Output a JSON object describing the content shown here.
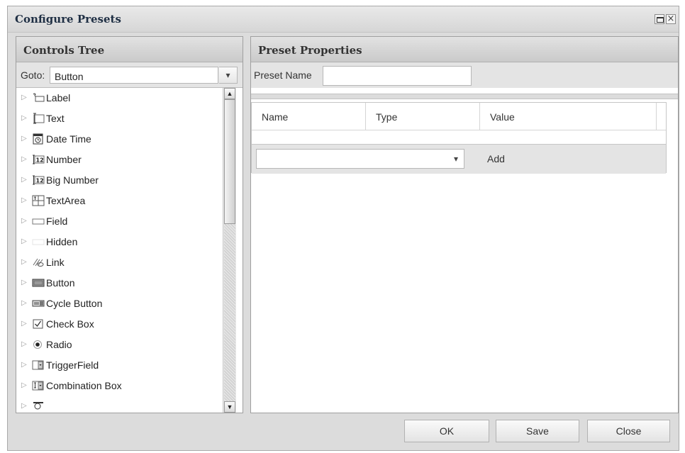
{
  "window": {
    "title": "Configure Presets",
    "maximize_icon": "maximize-icon",
    "close_glyph": "×"
  },
  "left_panel": {
    "header": "Controls Tree",
    "goto_label": "Goto:",
    "goto_value": "Button",
    "goto_trigger": "▾",
    "tree_items": [
      {
        "label": "Label",
        "icon": "label-icon"
      },
      {
        "label": "Text",
        "icon": "text-icon"
      },
      {
        "label": "Date Time",
        "icon": "datetime-icon"
      },
      {
        "label": "Number",
        "icon": "number-icon"
      },
      {
        "label": "Big Number",
        "icon": "big-number-icon"
      },
      {
        "label": "TextArea",
        "icon": "textarea-icon"
      },
      {
        "label": "Field",
        "icon": "field-icon"
      },
      {
        "label": "Hidden",
        "icon": "hidden-icon"
      },
      {
        "label": "Link",
        "icon": "link-icon"
      },
      {
        "label": "Button",
        "icon": "button-icon"
      },
      {
        "label": "Cycle Button",
        "icon": "cycle-button-icon"
      },
      {
        "label": "Check Box",
        "icon": "checkbox-icon"
      },
      {
        "label": "Radio",
        "icon": "radio-icon"
      },
      {
        "label": "TriggerField",
        "icon": "triggerfield-icon"
      },
      {
        "label": "Combination Box",
        "icon": "combobox-icon"
      },
      {
        "label": "",
        "icon": "partial-icon"
      }
    ],
    "scroll_up": "▲",
    "scroll_down": "▼",
    "expander": "▷"
  },
  "right_panel": {
    "header": "Preset Properties",
    "preset_name_label": "Preset Name",
    "preset_name_value": "",
    "columns": [
      "Name",
      "Type",
      "Value"
    ],
    "add_trigger": "▾",
    "add_label": "Add"
  },
  "footer": {
    "ok": "OK",
    "save": "Save",
    "close": "Close"
  }
}
